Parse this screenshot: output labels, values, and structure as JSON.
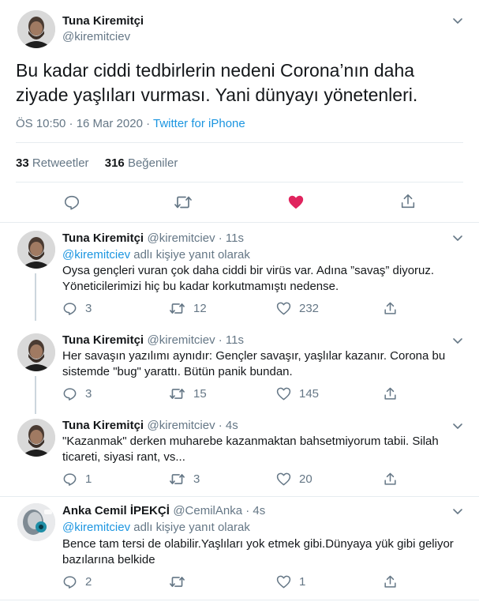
{
  "main_tweet": {
    "author_name": "Tuna Kiremitçi",
    "author_handle": "@kiremitciev",
    "text_line1": "Bu kadar ciddi tedbirlerin nedeni Corona’nın daha",
    "text_line2": "ziyade yaşlıları vurması. Yani dünyayı yönetenleri.",
    "time": "ÖS 10:50 · 16 Mar 2020",
    "separator": " · ",
    "source": "Twitter for iPhone",
    "retweets_count": "33",
    "retweets_label": "Retweetler",
    "likes_count": "316",
    "likes_label": "Beğeniler"
  },
  "replies": [
    {
      "author_name": "Tuna Kiremitçi",
      "author_handle": "@kiremitciev · 11s",
      "reply_to_handle": "@kiremitciev",
      "reply_to_suffix": " adlı kişiye yanıt olarak",
      "line1": "Oysa gençleri vuran çok daha ciddi bir virüs var. Adına ”savaş” diyoruz.",
      "line2": "Yöneticilerimizi hiç bu kadar korkutmamıştı nedense.",
      "replies": "3",
      "retweets": "12",
      "likes": "232"
    },
    {
      "author_name": "Tuna Kiremitçi",
      "author_handle": "@kiremitciev · 11s",
      "line1": "Her savaşın yazılımı aynıdır: Gençler savaşır, yaşlılar kazanır. Corona bu",
      "line2": "sistemde \"bug\" yarattı. Bütün panik bundan.",
      "replies": "3",
      "retweets": "15",
      "likes": "145"
    },
    {
      "author_name": "Tuna Kiremitçi",
      "author_handle": "@kiremitciev · 4s",
      "line1": "\"Kazanmak\" derken muharebe kazanmaktan bahsetmiyorum tabii. Silah",
      "line2": "ticareti, siyasi rant, vs...",
      "replies": "1",
      "retweets": "3",
      "likes": "20"
    },
    {
      "author_name": "Anka Cemil İPEKÇİ",
      "author_handle": "@CemilAnka · 4s",
      "reply_to_handle": "@kiremitciev",
      "reply_to_suffix": " adlı kişiye yanıt olarak",
      "line1": "Bence tam tersi de olabilir.Yaşlıları yok etmek gibi.Dünyaya yük gibi geliyor",
      "line2": "bazılarına belkide",
      "replies": "2",
      "retweets": "",
      "likes": "1"
    }
  ],
  "colors": {
    "like_active": "#e0245e",
    "link": "#1b95e0",
    "muted": "#657786",
    "divider": "#e6ecf0"
  },
  "icons": [
    "reply-icon",
    "retweet-icon",
    "like-icon",
    "share-icon",
    "chevron-down-icon",
    "avatar"
  ]
}
